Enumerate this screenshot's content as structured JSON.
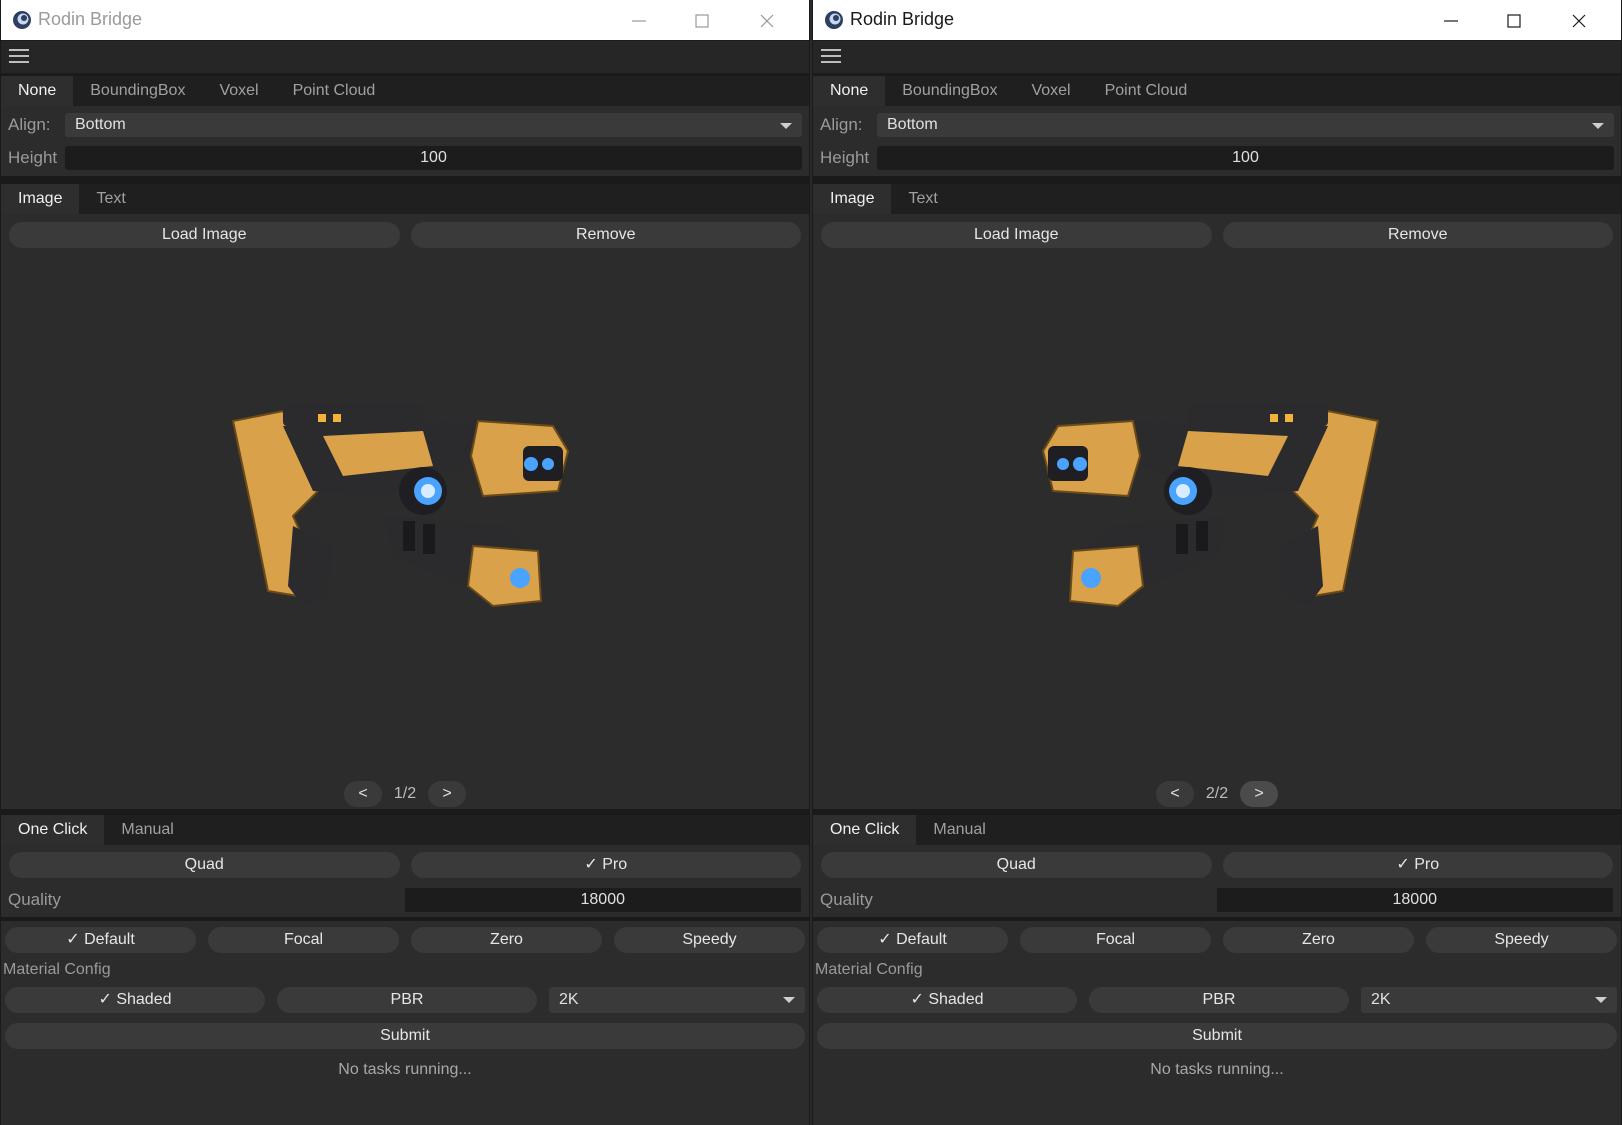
{
  "windows": [
    {
      "id": "left",
      "title": "Rodin Bridge",
      "bbox_tabs": [
        "None",
        "BoundingBox",
        "Voxel",
        "Point Cloud"
      ],
      "align_label": "Align:",
      "align_value": "Bottom",
      "height_label": "Height",
      "height_value": "100",
      "input_tabs": [
        "Image",
        "Text"
      ],
      "load_image": "Load Image",
      "remove": "Remove",
      "prev": "<",
      "next": ">",
      "page_indicator": "1/2",
      "gen_tabs": [
        "One Click",
        "Manual"
      ],
      "quad": "Quad",
      "pro": "✓ Pro",
      "quality_label": "Quality",
      "quality_value": "18000",
      "modes": [
        "✓ Default",
        "Focal",
        "Zero",
        "Speedy"
      ],
      "material_label": "Material Config",
      "shaded": "✓ Shaded",
      "pbr": "PBR",
      "resolution": "2K",
      "submit": "Submit",
      "status": "No tasks running..."
    },
    {
      "id": "right",
      "title": "Rodin Bridge",
      "bbox_tabs": [
        "None",
        "BoundingBox",
        "Voxel",
        "Point Cloud"
      ],
      "align_label": "Align:",
      "align_value": "Bottom",
      "height_label": "Height",
      "height_value": "100",
      "input_tabs": [
        "Image",
        "Text"
      ],
      "load_image": "Load Image",
      "remove": "Remove",
      "prev": "<",
      "next": ">",
      "page_indicator": "2/2",
      "gen_tabs": [
        "One Click",
        "Manual"
      ],
      "quad": "Quad",
      "pro": "✓ Pro",
      "quality_label": "Quality",
      "quality_value": "18000",
      "modes": [
        "✓ Default",
        "Focal",
        "Zero",
        "Speedy"
      ],
      "material_label": "Material Config",
      "shaded": "✓ Shaded",
      "pbr": "PBR",
      "resolution": "2K",
      "submit": "Submit",
      "status": "No tasks running..."
    }
  ],
  "colors": {
    "window_bg": "#2c2c2c",
    "button_bg": "#3a3a3a",
    "field_bg": "#1c1c1c",
    "gun_gold": "#d9a24a",
    "gun_dark": "#2b2b2e",
    "glow_blue": "#4aa3ff"
  },
  "icons": [
    "app-logo-icon",
    "minimize-icon",
    "maximize-icon",
    "close-icon",
    "hamburger-menu-icon",
    "dropdown-arrow-icon"
  ]
}
